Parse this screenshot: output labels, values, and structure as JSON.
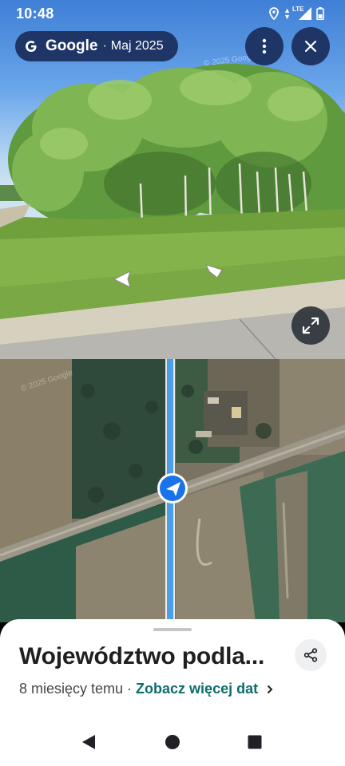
{
  "status_bar": {
    "time": "10:48",
    "icons": [
      "location-icon",
      "data-arrows-icon",
      "signal-lte-icon",
      "battery-icon"
    ],
    "network_label": "LTE"
  },
  "header": {
    "brand": "Google",
    "separator": "·",
    "capture_date": "Maj 2025",
    "watermark": "© 2025 Google"
  },
  "buttons": {
    "more": "more-vert-icon",
    "close": "close-icon",
    "expand": "expand-icon"
  },
  "map": {
    "watermark": "© 2025 Google",
    "pegman_icon": "navigation-arrow-icon",
    "route_color": "#4a9fe8"
  },
  "place": {
    "title": "Województwo podla...",
    "relative_date": "8 miesięcy temu",
    "separator": "·",
    "more_dates_link": "Zobacz więcej dat",
    "share_icon": "share-icon"
  },
  "colors": {
    "accent_link": "#0b6d6e",
    "pill_bg": "#1f3566",
    "route_blue": "#4a9fe8"
  },
  "nav_bar": {
    "back": "back-triangle-icon",
    "home": "home-circle-icon",
    "recents": "recents-square-icon"
  }
}
